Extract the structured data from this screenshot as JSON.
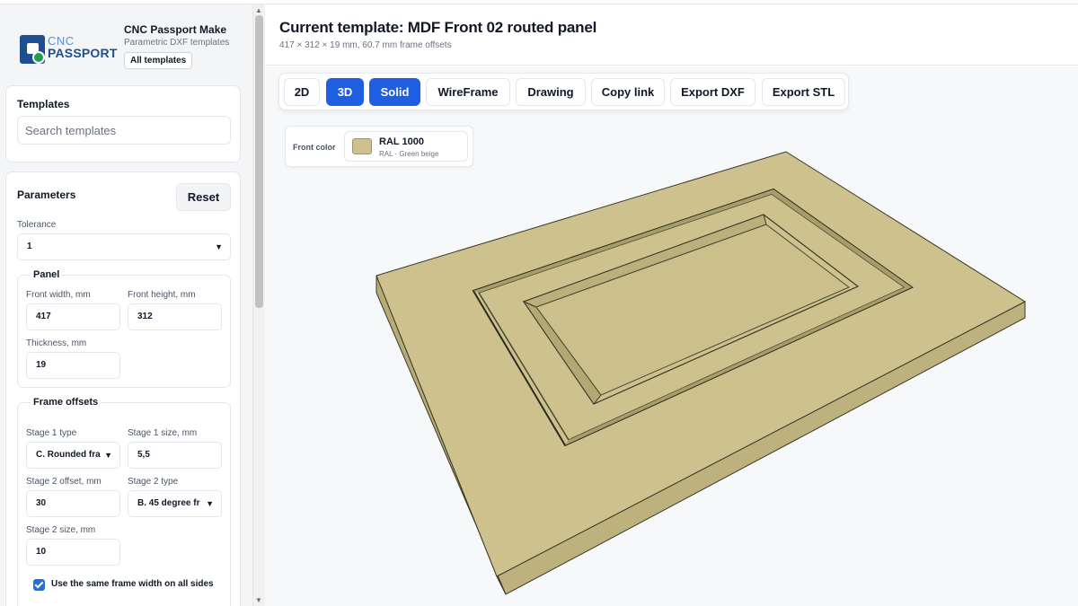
{
  "brand": {
    "logo_top": "CNC",
    "logo_bottom": "PASSPORT",
    "name": "CNC Passport Make",
    "subtitle": "Parametric DXF templates",
    "all_templates": "All templates"
  },
  "templates": {
    "title": "Templates",
    "search_placeholder": "Search templates",
    "search_value": ""
  },
  "parameters": {
    "title": "Parameters",
    "reset_label": "Reset",
    "tolerance_label": "Tolerance",
    "tolerance_value": "1",
    "panel": {
      "legend": "Panel",
      "front_width_label": "Front width, mm",
      "front_width_value": "417",
      "front_height_label": "Front height, mm",
      "front_height_value": "312",
      "thickness_label": "Thickness, mm",
      "thickness_value": "19"
    },
    "frame": {
      "legend": "Frame offsets",
      "stage1_type_label": "Stage 1 type",
      "stage1_type_value": "C. Rounded fra",
      "stage1_size_label": "Stage 1 size, mm",
      "stage1_size_value": "5,5",
      "stage2_offset_label": "Stage 2 offset, mm",
      "stage2_offset_value": "30",
      "stage2_type_label": "Stage 2 type",
      "stage2_type_value": "B. 45 degree fr",
      "stage2_size_label": "Stage 2 size, mm",
      "stage2_size_value": "10"
    },
    "same_width_label": "Use the same frame width on all sides",
    "same_width_checked": true
  },
  "header": {
    "title": "Current template: MDF Front 02 routed panel",
    "subtitle": "417 × 312 × 19 mm, 60.7 mm frame offsets"
  },
  "toolbar": {
    "buttons": [
      "2D",
      "3D",
      "Solid",
      "WireFrame",
      "Drawing",
      "Copy link",
      "Export DXF",
      "Export STL"
    ],
    "active": [
      "3D",
      "Solid"
    ]
  },
  "front_color": {
    "label": "Front color",
    "code": "RAL 1000",
    "name": "RAL · Green beige",
    "hex": "#cdc28d"
  },
  "colors": {
    "accent": "#1d5fe0",
    "panel_top": "#cdc28d",
    "panel_side": "#bdb27e",
    "panel_edge": "#2b2a1f"
  }
}
